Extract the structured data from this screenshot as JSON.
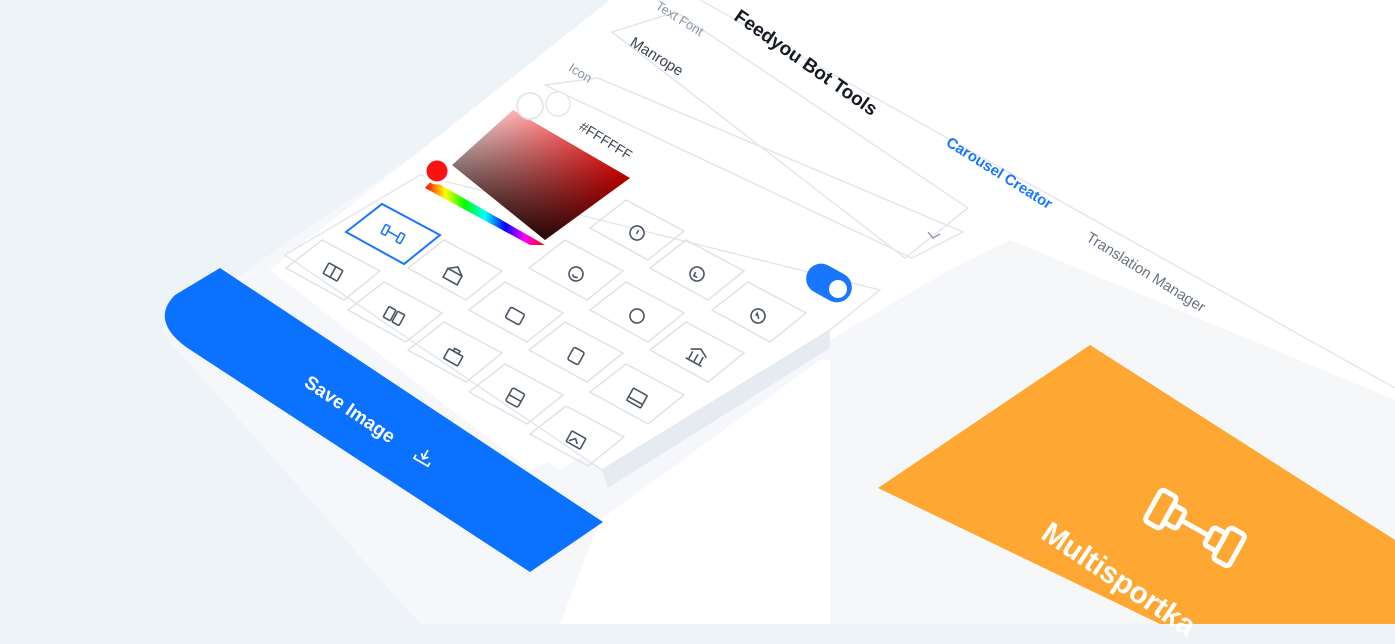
{
  "app": {
    "title": "Feedyou Bot Tools",
    "nav": [
      {
        "label": "Carousel Creator",
        "active": true
      },
      {
        "label": "Translation Manager",
        "active": false
      }
    ]
  },
  "form": {
    "text_font_label": "Text Font",
    "text_font_value": "Manrope",
    "icon_label": "Icon",
    "color_value": "#FFFFFF",
    "toggle_on": true
  },
  "save_button": {
    "label": "Save Image"
  },
  "preview": {
    "text": "Multisportka",
    "background": "#ffa733"
  },
  "colors": {
    "accent": "#1976ff",
    "preview_bg": "#ffa733"
  },
  "icons": [
    "dumbbell-icon",
    "book-icon",
    "bank-icon",
    "smile-icon",
    "arrow-down-left-icon",
    "alarm-icon",
    "card-icon",
    "battery-icon",
    "balloon-icon",
    "arrow-up-left-icon",
    "briefcase-icon",
    "beer-icon",
    "museum-icon",
    "bus-icon",
    "book-open-icon",
    "image-icon"
  ]
}
